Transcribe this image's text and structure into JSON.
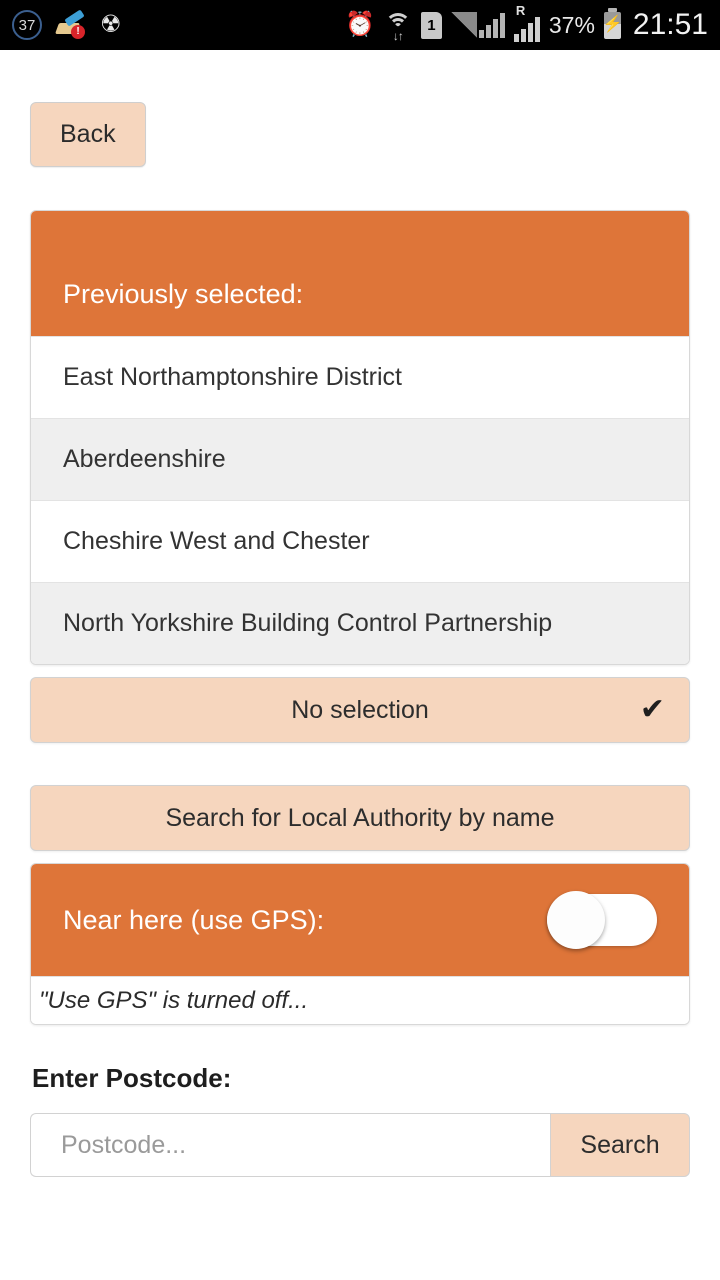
{
  "statusbar": {
    "battery_circle_value": "37",
    "cleaner_alert_glyph": "!",
    "usb_icon": "usb-icon",
    "alarm_icon": "alarm-icon",
    "wifi_icon": "wifi-icon",
    "wifi_transfer_glyph": "↓↑",
    "sim_label": "1",
    "roaming_label": "R",
    "battery_percent": "37%",
    "battery_charging_glyph": "⚡",
    "clock": "21:51"
  },
  "toolbar": {
    "back_label": "Back"
  },
  "previously_selected": {
    "header": "Previously selected:",
    "items": [
      "East Northamptonshire District",
      "Aberdeenshire",
      "Cheshire West and Chester",
      "North Yorkshire Building Control Partnership"
    ],
    "no_selection_label": "No selection",
    "no_selection_tick": "✔"
  },
  "search_by_name": {
    "label": "Search for Local Authority by name"
  },
  "gps": {
    "label": "Near here (use GPS):",
    "toggle_state": "off",
    "note": "\"Use GPS\" is turned off..."
  },
  "postcode": {
    "label": "Enter Postcode:",
    "placeholder": "Postcode...",
    "value": "",
    "search_label": "Search"
  },
  "colors": {
    "accent_orange": "#de7539",
    "peach": "#f6d6be",
    "row_alt": "#efefef",
    "status_bar": "#000000"
  }
}
